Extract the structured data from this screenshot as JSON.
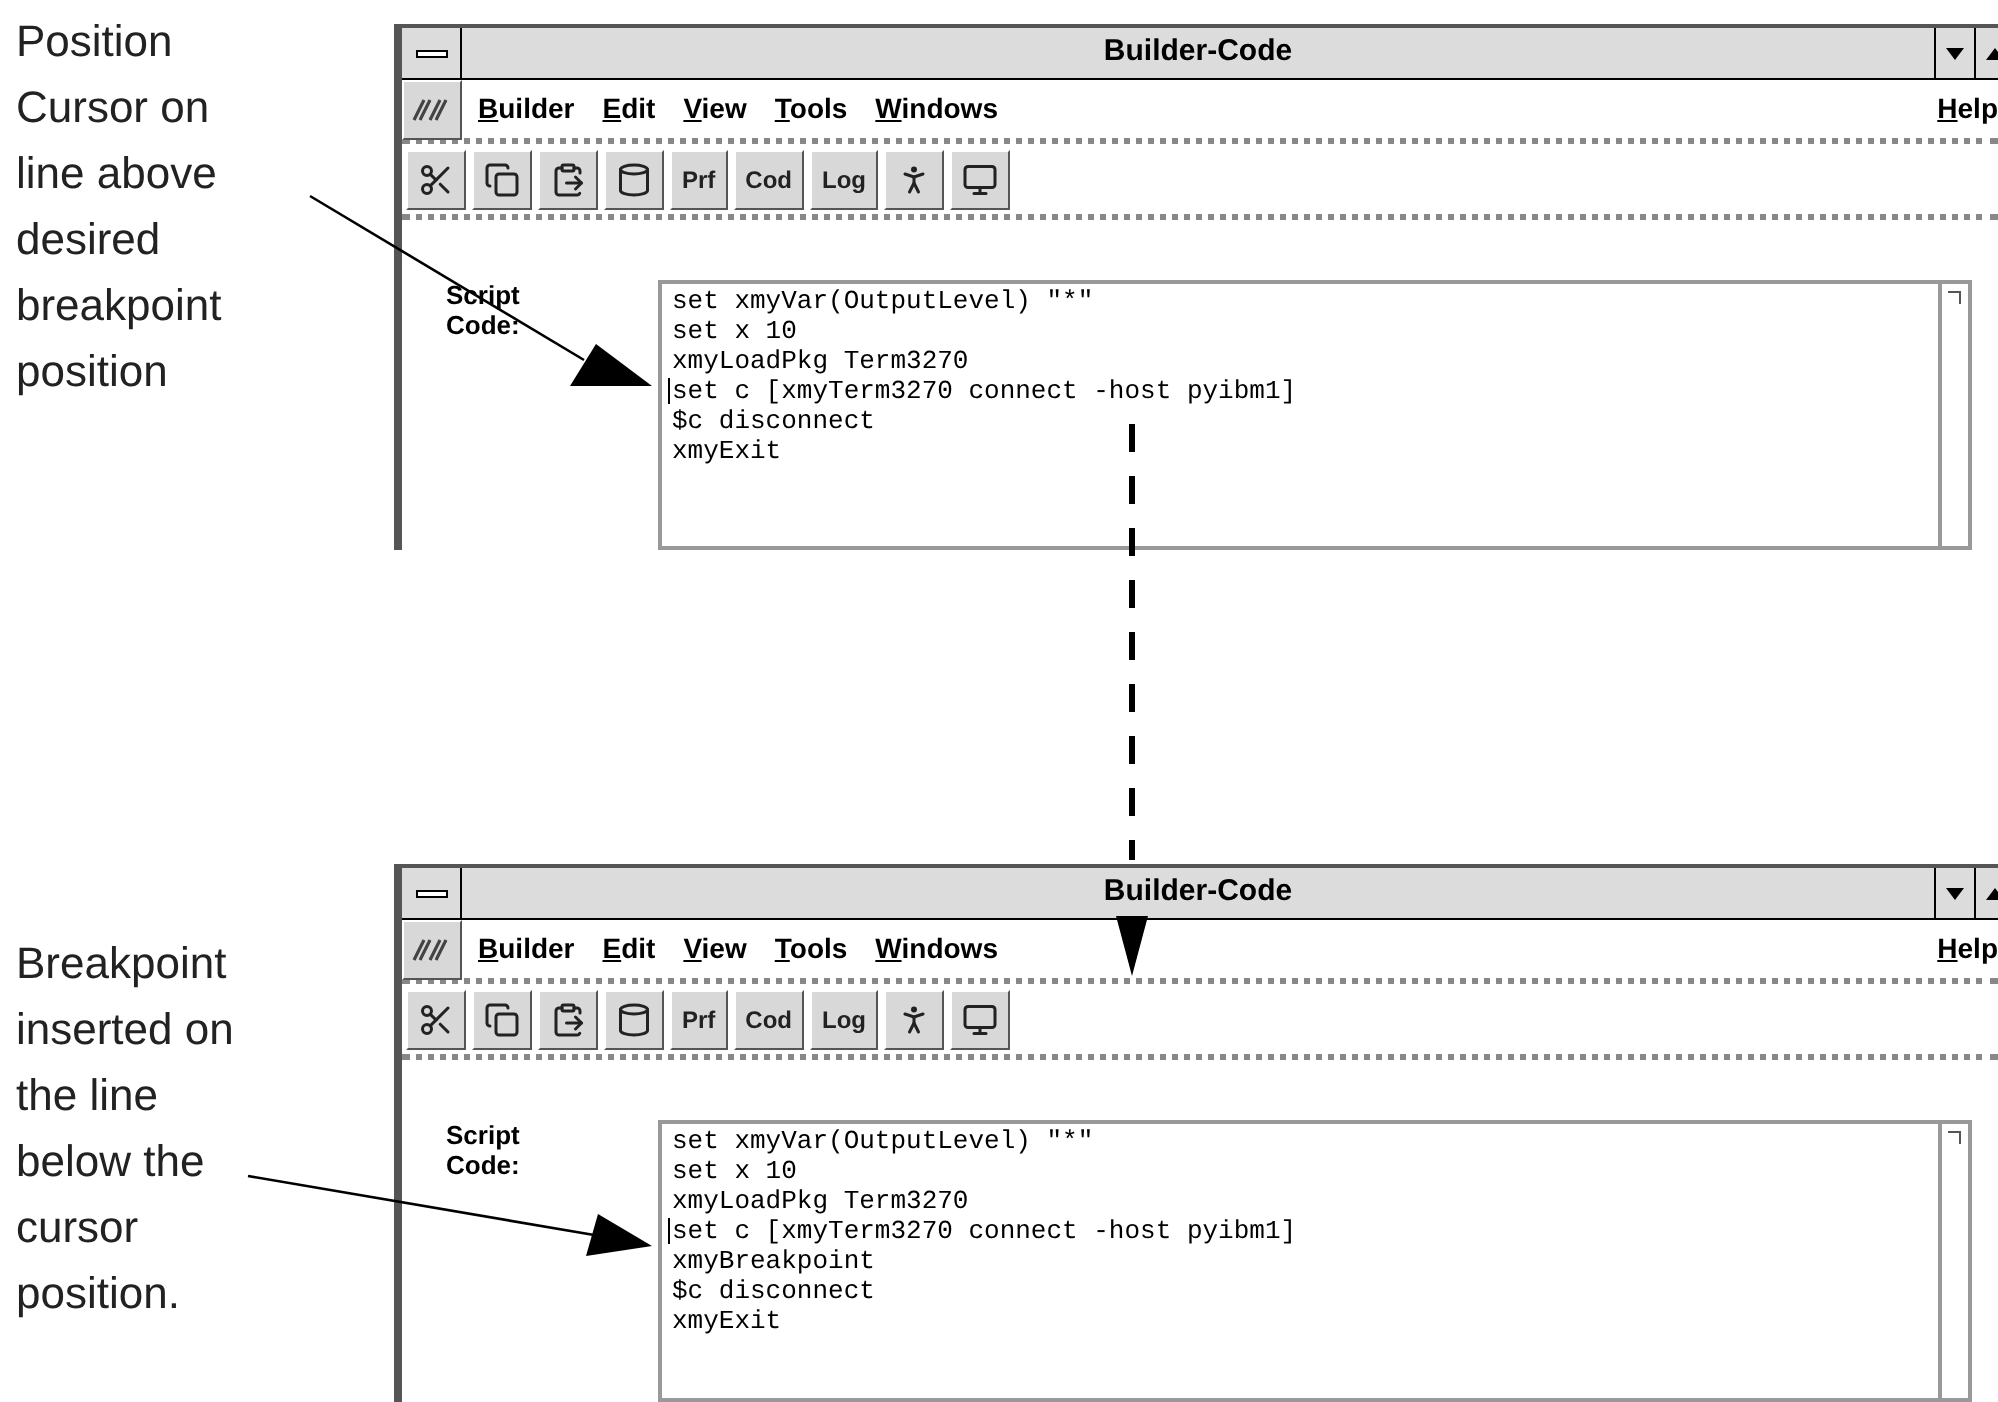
{
  "figures": [
    {
      "caption": "Position Cursor on line above desired breakpoint position",
      "window": {
        "title": "Builder-Code",
        "menus": [
          "Builder",
          "Edit",
          "View",
          "Tools",
          "Windows"
        ],
        "help": "Help",
        "toolbar_text_buttons": [
          "Prf",
          "Cod",
          "Log"
        ],
        "field_label": "Script Code:",
        "code_lines": [
          {
            "text": "set xmyVar(OutputLevel) \"*\"",
            "cursor": false
          },
          {
            "text": "set x 10",
            "cursor": false
          },
          {
            "text": "xmyLoadPkg Term3270",
            "cursor": false
          },
          {
            "text": "set c [xmyTerm3270 connect -host pyibm1]",
            "cursor": true
          },
          {
            "text": "$c disconnect",
            "cursor": false
          },
          {
            "text": "xmyExit",
            "cursor": false
          }
        ]
      }
    },
    {
      "caption": "Breakpoint inserted on the line below the cursor position.",
      "window": {
        "title": "Builder-Code",
        "menus": [
          "Builder",
          "Edit",
          "View",
          "Tools",
          "Windows"
        ],
        "help": "Help",
        "toolbar_text_buttons": [
          "Prf",
          "Cod",
          "Log"
        ],
        "field_label": "Script Code:",
        "code_lines": [
          {
            "text": "set xmyVar(OutputLevel) \"*\"",
            "cursor": false
          },
          {
            "text": "set x 10",
            "cursor": false
          },
          {
            "text": "xmyLoadPkg Term3270",
            "cursor": false
          },
          {
            "text": "set c [xmyTerm3270 connect -host pyibm1]",
            "cursor": true
          },
          {
            "text": "xmyBreakpoint",
            "cursor": false
          },
          {
            "text": "$c disconnect",
            "cursor": false
          },
          {
            "text": "xmyExit",
            "cursor": false
          }
        ]
      }
    }
  ]
}
